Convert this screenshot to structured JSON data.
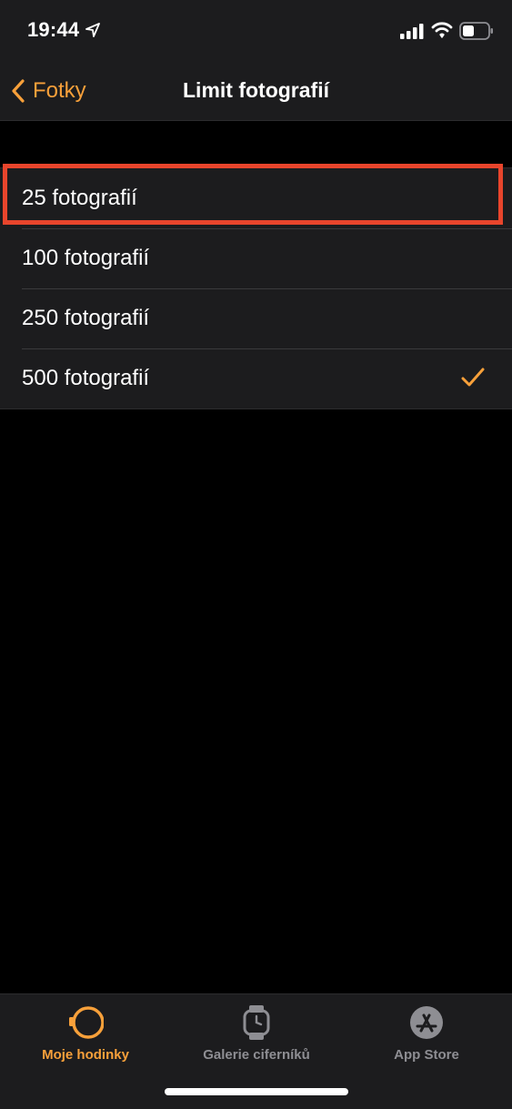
{
  "status_bar": {
    "time": "19:44",
    "icons": [
      "location-arrow-icon",
      "cellular-signal-icon",
      "wifi-icon",
      "battery-icon"
    ]
  },
  "nav": {
    "back_label": "Fotky",
    "title": "Limit fotografií"
  },
  "options": [
    {
      "label": "25 fotografií",
      "selected": false,
      "highlighted": true
    },
    {
      "label": "100 fotografií",
      "selected": false,
      "highlighted": false
    },
    {
      "label": "250 fotografií",
      "selected": false,
      "highlighted": false
    },
    {
      "label": "500 fotografií",
      "selected": true,
      "highlighted": false
    }
  ],
  "tabs": [
    {
      "label": "Moje hodinky",
      "icon": "watch-icon",
      "active": true
    },
    {
      "label": "Galerie ciferníků",
      "icon": "watch-face-gallery-icon",
      "active": false
    },
    {
      "label": "App Store",
      "icon": "app-store-icon",
      "active": false
    }
  ],
  "colors": {
    "accent": "#f7a03a",
    "highlight": "#e8452c",
    "background": "#000000",
    "surface": "#1c1c1e",
    "inactive": "#8e8e93"
  }
}
